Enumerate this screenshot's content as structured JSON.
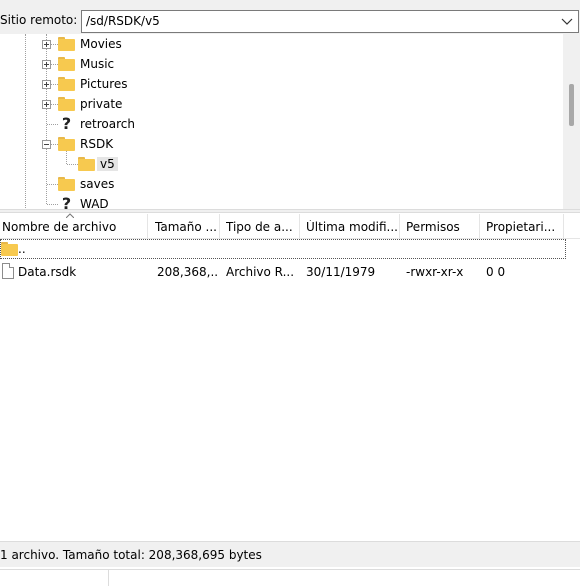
{
  "remote": {
    "label": "Sitio remoto:",
    "path": "/sd/RSDK/v5"
  },
  "tree": {
    "items": [
      {
        "label": "Movies",
        "icon": "folder-icon",
        "expander": "plus"
      },
      {
        "label": "Music",
        "icon": "folder-icon",
        "expander": "plus"
      },
      {
        "label": "Pictures",
        "icon": "folder-icon",
        "expander": "plus"
      },
      {
        "label": "private",
        "icon": "folder-icon",
        "expander": "plus"
      },
      {
        "label": "retroarch",
        "icon": "unknown-folder-icon",
        "expander": "none"
      },
      {
        "label": "RSDK",
        "icon": "folder-icon",
        "expander": "minus"
      },
      {
        "label": "v5",
        "icon": "folder-icon",
        "expander": "none",
        "selected": true
      },
      {
        "label": "saves",
        "icon": "folder-icon",
        "expander": "none"
      },
      {
        "label": "WAD",
        "icon": "unknown-folder-icon",
        "expander": "none"
      }
    ]
  },
  "list": {
    "columns": [
      {
        "label": "Nombre de archivo"
      },
      {
        "label": "Tamaño ..."
      },
      {
        "label": "Tipo de a..."
      },
      {
        "label": "Última modifi..."
      },
      {
        "label": "Permisos"
      },
      {
        "label": "Propietari..."
      }
    ],
    "parent_row": {
      "name": ".."
    },
    "rows": [
      {
        "name": "Data.rsdk",
        "size": "208,368,...",
        "type": "Archivo R...",
        "modified": "30/11/1979",
        "permissions": "-rwxr-xr-x",
        "owner": "0 0"
      }
    ]
  },
  "status": {
    "text": "1 archivo. Tamaño total: 208,368,695 bytes"
  },
  "colors": {
    "folder": "#f7c94f",
    "selection": "#e5e5e5",
    "chrome": "#f0f0f0"
  }
}
